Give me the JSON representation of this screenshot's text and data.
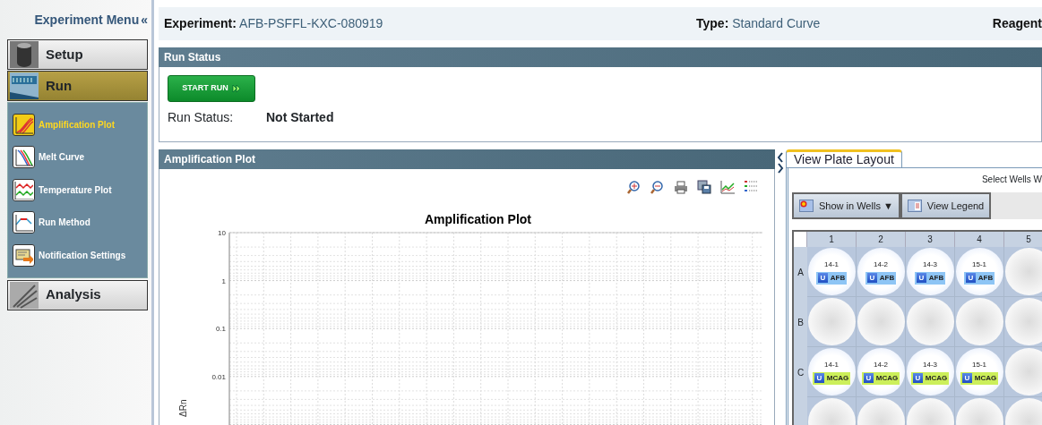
{
  "sidebar": {
    "title": "Experiment Menu",
    "collapse_glyph": "«",
    "sections": [
      {
        "label": "Setup",
        "selected": false
      },
      {
        "label": "Run",
        "selected": true,
        "items": [
          {
            "label": "Amplification Plot",
            "selected": true
          },
          {
            "label": "Melt Curve",
            "selected": false
          },
          {
            "label": "Temperature Plot",
            "selected": false
          },
          {
            "label": "Run Method",
            "selected": false
          },
          {
            "label": "Notification Settings",
            "selected": false
          }
        ]
      },
      {
        "label": "Analysis",
        "selected": false
      }
    ]
  },
  "header": {
    "fields": [
      {
        "label": "Experiment:",
        "value": "AFB-PSFFL-KXC-080919"
      },
      {
        "label": "Type:",
        "value": "Standard Curve"
      },
      {
        "label": "Reagent"
      }
    ]
  },
  "run_status": {
    "title": "Run Status",
    "button": "START RUN",
    "status_label": "Run Status:",
    "status_value": "Not Started"
  },
  "amplification": {
    "title": "Amplification Plot",
    "plot": {
      "title": "Amplification Plot",
      "ylabel": "ΔRn",
      "yticks": [
        "10",
        "1",
        "0.1",
        "0.01"
      ]
    }
  },
  "plate": {
    "tab": "View Plate Layout",
    "select_text": "Select Wells W",
    "buttons": [
      "Show in Wells ▼",
      "View Legend"
    ],
    "columns": [
      "1",
      "2",
      "3",
      "4",
      "5"
    ],
    "rows": [
      {
        "label": "A",
        "wells": [
          {
            "kind": "sample",
            "sample": "14-1",
            "task": "U",
            "target": "AFB",
            "color": "#8ec5f5"
          },
          {
            "kind": "sample",
            "sample": "14-2",
            "task": "U",
            "target": "AFB",
            "color": "#8ec5f5"
          },
          {
            "kind": "sample",
            "sample": "14-3",
            "task": "U",
            "target": "AFB",
            "color": "#8ec5f5"
          },
          {
            "kind": "sample",
            "sample": "15-1",
            "task": "U",
            "target": "AFB",
            "color": "#8ec5f5"
          },
          {
            "kind": "empty"
          }
        ]
      },
      {
        "label": "B",
        "wells": [
          {
            "kind": "empty"
          },
          {
            "kind": "empty"
          },
          {
            "kind": "empty"
          },
          {
            "kind": "empty"
          },
          {
            "kind": "empty"
          }
        ]
      },
      {
        "label": "C",
        "wells": [
          {
            "kind": "sample",
            "sample": "14-1",
            "task": "U",
            "target": "MCAG",
            "color": "#ccef5a"
          },
          {
            "kind": "sample",
            "sample": "14-2",
            "task": "U",
            "target": "MCAG",
            "color": "#ccef5a"
          },
          {
            "kind": "sample",
            "sample": "14-3",
            "task": "U",
            "target": "MCAG",
            "color": "#ccef5a"
          },
          {
            "kind": "sample",
            "sample": "15-1",
            "task": "U",
            "target": "MCAG",
            "color": "#ccef5a"
          },
          {
            "kind": "empty"
          }
        ]
      },
      {
        "wells": [
          {
            "kind": "empty"
          },
          {
            "kind": "empty"
          },
          {
            "kind": "empty"
          },
          {
            "kind": "empty"
          },
          {
            "kind": "empty"
          }
        ]
      }
    ]
  }
}
